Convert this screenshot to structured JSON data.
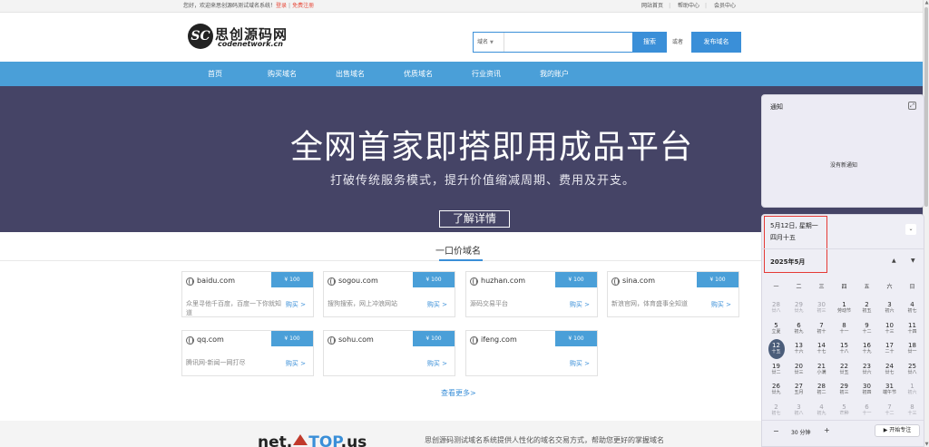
{
  "topbar": {
    "welcome": "您好，欢迎来思创源码测试域名系统！",
    "login": "登录",
    "divider": "|",
    "register": "免费注册",
    "links": [
      "网站首页",
      "帮助中心",
      "会员中心"
    ]
  },
  "logo": {
    "cn": "思创源码网",
    "en": "codenetwork.cn",
    "mark": "SC"
  },
  "search": {
    "select_value": "域名",
    "placeholder": "",
    "button": "搜索",
    "or": "或者",
    "publish": "发布域名"
  },
  "nav": [
    "首页",
    "购买域名",
    "出售域名",
    "优质域名",
    "行业资讯",
    "我的账户"
  ],
  "hero": {
    "title": "全网首家即搭即用成品平台",
    "subtitle": "打破传统服务模式，提升价值缩减周期、费用及开支。",
    "button": "了解详情"
  },
  "section": {
    "title": "一口价域名",
    "see_more": "查看更多>"
  },
  "cards": [
    {
      "domain": "baidu.com",
      "price": "¥ 100",
      "desc": "众里寻他千百度，百度一下你就知道",
      "buy": "购买 >"
    },
    {
      "domain": "sogou.com",
      "price": "¥ 100",
      "desc": "搜狗搜索，网上冲浪网站",
      "buy": "购买 >"
    },
    {
      "domain": "huzhan.com",
      "price": "¥ 100",
      "desc": "源码交易平台",
      "buy": "购买 >"
    },
    {
      "domain": "sina.com",
      "price": "¥ 100",
      "desc": "新浪官网，体育盛事全知道",
      "buy": "购买 >"
    },
    {
      "domain": "qq.com",
      "price": "¥ 100",
      "desc": "腾讯网-新闻一网打尽",
      "buy": "购买 >"
    },
    {
      "domain": "sohu.com",
      "price": "¥ 100",
      "desc": "",
      "buy": "购买 >"
    },
    {
      "domain": "ifeng.com",
      "price": "¥ 100",
      "desc": "",
      "buy": "购买 >"
    }
  ],
  "footer": {
    "logo_a": "net.",
    "logo_b": "TOP",
    "logo_c": ".us",
    "text": "思创源码测试域名系统提供人性化的域名交易方式，帮助您更好的掌握域名"
  },
  "notifications": {
    "title": "通知",
    "empty": "没有新通知"
  },
  "calendar": {
    "date": "5月12日, 星期一",
    "lunar": "四月十五",
    "month": "2025年5月",
    "weekdays": [
      "一",
      "二",
      "三",
      "四",
      "五",
      "六",
      "日"
    ],
    "weeks": [
      [
        [
          "28",
          "廿八",
          1
        ],
        [
          "29",
          "廿九",
          1
        ],
        [
          "30",
          "初三",
          1
        ],
        [
          "1",
          "劳动节",
          0
        ],
        [
          "2",
          "初五",
          0
        ],
        [
          "3",
          "初六",
          0
        ],
        [
          "4",
          "初七",
          0
        ]
      ],
      [
        [
          "5",
          "立夏",
          0
        ],
        [
          "6",
          "初九",
          0
        ],
        [
          "7",
          "初十",
          0
        ],
        [
          "8",
          "十一",
          0
        ],
        [
          "9",
          "十二",
          0
        ],
        [
          "10",
          "十三",
          0
        ],
        [
          "11",
          "十四",
          0
        ]
      ],
      [
        [
          "12",
          "十五",
          0
        ],
        [
          "13",
          "十六",
          0
        ],
        [
          "14",
          "十七",
          0
        ],
        [
          "15",
          "十八",
          0
        ],
        [
          "16",
          "十九",
          0
        ],
        [
          "17",
          "二十",
          0
        ],
        [
          "18",
          "廿一",
          0
        ]
      ],
      [
        [
          "19",
          "廿二",
          0
        ],
        [
          "20",
          "廿三",
          0
        ],
        [
          "21",
          "小满",
          0
        ],
        [
          "22",
          "廿五",
          0
        ],
        [
          "23",
          "廿六",
          0
        ],
        [
          "24",
          "廿七",
          0
        ],
        [
          "25",
          "廿八",
          0
        ]
      ],
      [
        [
          "26",
          "廿九",
          0
        ],
        [
          "27",
          "五月",
          0
        ],
        [
          "28",
          "初二",
          0
        ],
        [
          "29",
          "初三",
          0
        ],
        [
          "30",
          "初四",
          0
        ],
        [
          "31",
          "端午节",
          0
        ],
        [
          "1",
          "初六",
          1
        ]
      ],
      [
        [
          "2",
          "初七",
          1
        ],
        [
          "3",
          "初八",
          1
        ],
        [
          "4",
          "初九",
          1
        ],
        [
          "5",
          "芒种",
          1
        ],
        [
          "6",
          "十一",
          1
        ],
        [
          "7",
          "十二",
          1
        ],
        [
          "8",
          "十三",
          1
        ]
      ]
    ],
    "today_index": [
      2,
      0
    ],
    "focus_minutes": "30 分钟",
    "focus_button": "▶ 开始专注"
  }
}
